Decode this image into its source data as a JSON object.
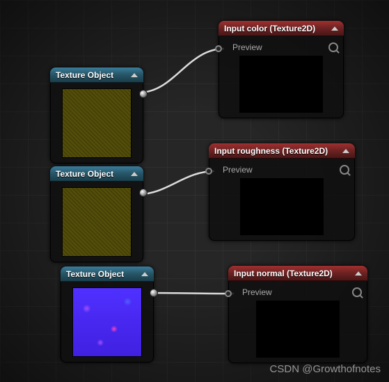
{
  "nodes": {
    "tex1": {
      "title": "Texture Object"
    },
    "tex2": {
      "title": "Texture Object"
    },
    "tex3": {
      "title": "Texture Object"
    },
    "color": {
      "title": "Input color (Texture2D)",
      "preview_label": "Preview"
    },
    "roughness": {
      "title": "Input roughness (Texture2D)",
      "preview_label": "Preview"
    },
    "normal": {
      "title": "Input normal (Texture2D)",
      "preview_label": "Preview"
    }
  },
  "watermark": "CSDN @Growthofnotes"
}
